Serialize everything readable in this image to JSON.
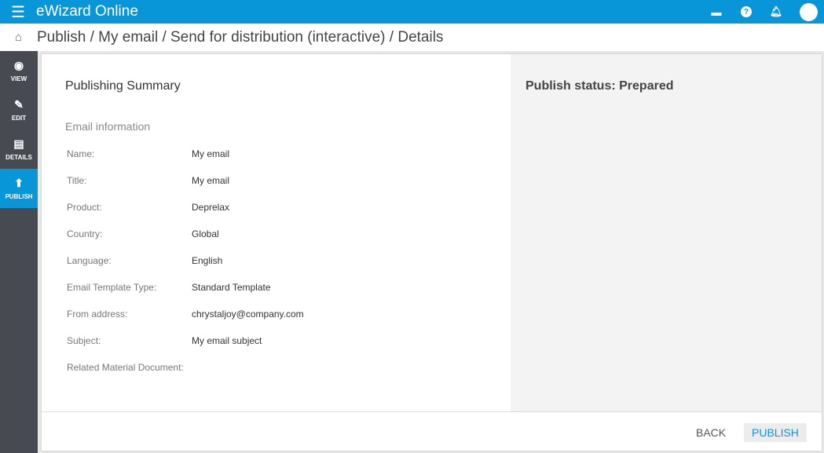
{
  "app": {
    "title": "eWizard Online"
  },
  "breadcrumb": "Publish / My email / Send for distribution (interactive) / Details",
  "sidebar": [
    {
      "label": "VIEW",
      "icon": "eye-icon"
    },
    {
      "label": "EDIT",
      "icon": "pencil-icon"
    },
    {
      "label": "DETAILS",
      "icon": "clipboard-icon"
    },
    {
      "label": "PUBLISH",
      "icon": "publish-icon"
    }
  ],
  "summary": {
    "title": "Publishing Summary",
    "section": "Email information",
    "rows": [
      {
        "k": "Name:",
        "v": "My email"
      },
      {
        "k": "Title:",
        "v": "My email"
      },
      {
        "k": "Product:",
        "v": "Deprelax"
      },
      {
        "k": "Country:",
        "v": "Global"
      },
      {
        "k": "Language:",
        "v": "English"
      },
      {
        "k": "Email Template Type:",
        "v": "Standard Template"
      },
      {
        "k": "From address:",
        "v": "chrystaljoy@company.com"
      },
      {
        "k": "Subject:",
        "v": "My email subject"
      },
      {
        "k": "Related Material Document:",
        "v": ""
      }
    ]
  },
  "status": "Publish status: Prepared",
  "buttons": {
    "back": "BACK",
    "publish": "PUBLISH"
  }
}
